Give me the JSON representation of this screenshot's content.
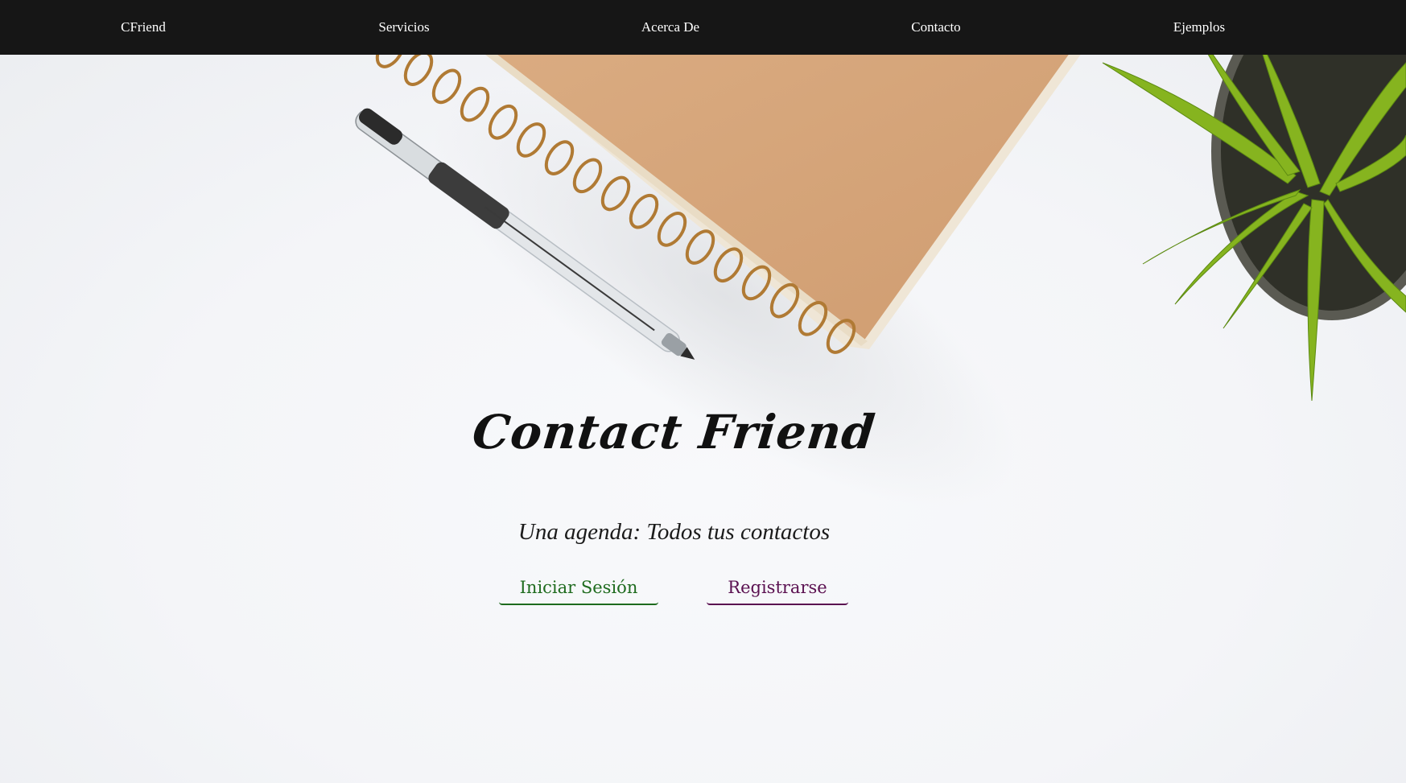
{
  "nav": {
    "brand": "CFriend",
    "items": [
      "Servicios",
      "Acerca De",
      "Contacto",
      "Ejemplos"
    ]
  },
  "hero": {
    "title": "Contact Friend",
    "subtitle": "Una agenda: Todos tus contactos",
    "login_label": "Iniciar Sesión",
    "register_label": "Registrarse"
  },
  "colors": {
    "navbar": "#161616",
    "login_accent": "#1e6b1e",
    "register_accent": "#5a1050",
    "notebook": "#d6a57a",
    "spiral": "#b5823c",
    "plant": "#7fae1c"
  },
  "icons": [
    "pen-image",
    "notebook-image",
    "plant-image"
  ]
}
